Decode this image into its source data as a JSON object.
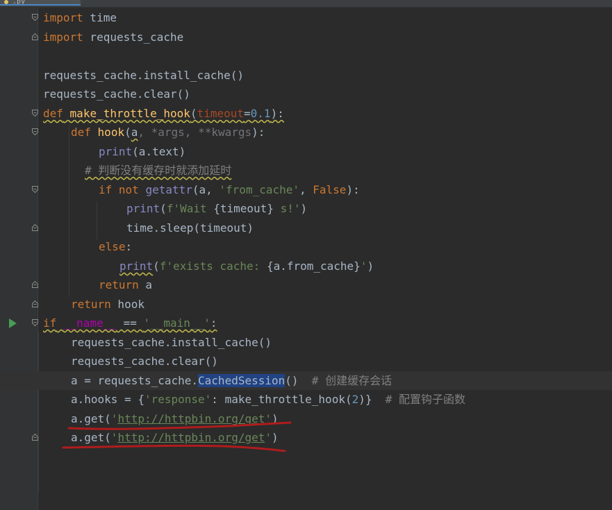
{
  "editor": {
    "tab_label": ".py",
    "colors": {
      "background": "#2b2b2b",
      "gutter": "#313335",
      "keyword": "#cc7832",
      "string": "#6a8759",
      "number": "#6897bb",
      "comment": "#808080",
      "function_def": "#ffc66d",
      "builtin": "#8888c6",
      "annotation_ink": "#b01c1c"
    },
    "lines": {
      "l1": {
        "k": "import",
        "t": " time"
      },
      "l2": {
        "k": "import",
        "t": " requests_cache"
      },
      "l4": {
        "t": "requests_cache.install_cache()"
      },
      "l5": {
        "t": "requests_cache.clear()"
      },
      "l6": {
        "k": "def",
        "sp": " ",
        "fn": "make_throttle_hook",
        "open": "(",
        "param": "timeout",
        "eq": "=",
        "num": "0.1",
        "close": "):"
      },
      "l7": {
        "k": "def",
        "sp": " ",
        "fn": "hook",
        "open": "(",
        "a": "a",
        "comma1": ", ",
        "args": "*args",
        "comma2": ", ",
        "kwargs": "**kwargs",
        "close": "):"
      },
      "l8": {
        "bi": "print",
        "t": "(a.text)"
      },
      "l9": {
        "cmt": "# 判断没有缓存时就添加延时"
      },
      "l10": {
        "k1": "if",
        "k2": " not",
        "sp": " ",
        "bi": "getattr",
        "t1": "(a, ",
        "str": "'from_cache'",
        "t2": ", ",
        "k3": "False",
        "t3": "):"
      },
      "l11": {
        "bi": "print",
        "t1": "(",
        "str1": "f'Wait ",
        "t2": "{timeout}",
        "str2": " s!'",
        "t3": ")"
      },
      "l12": {
        "t": "time.sleep(timeout)"
      },
      "l13": {
        "k": "else",
        "t": ":"
      },
      "l14": {
        "bi": "print",
        "t1": "(",
        "str1": "f'exists cache: ",
        "t2": "{a.from_cache}",
        "str2": "'",
        "t3": ")"
      },
      "l15": {
        "k": "return",
        "t": " a"
      },
      "l16": {
        "k": "return",
        "t": " hook"
      },
      "l17": {
        "k": "if",
        "sp": " ",
        "dunder": "__name__",
        "t1": " == ",
        "str": "'__main__'",
        "t2": ":"
      },
      "l18": {
        "t": "requests_cache.install_cache()"
      },
      "l19": {
        "t": "requests_cache.clear()"
      },
      "l20": {
        "t1": "a = requests_cache.",
        "sel": "CachedSession",
        "t2": "()  ",
        "cmt": "# 创建缓存会话"
      },
      "l21": {
        "t1": "a.hooks = {",
        "str": "'response'",
        "t2": ": make_throttle_hook(",
        "num": "2",
        "t3": ")}  ",
        "cmt": "# 配置钩子函数"
      },
      "l22": {
        "t1": "a.get(",
        "q1": "'",
        "url": "http://httpbin.org/get",
        "q2": "'",
        "t2": ")"
      },
      "l23": {
        "t1": "a.get(",
        "q1": "'",
        "url": "http://httpbin.org/get",
        "q2": "'",
        "t2": ")"
      }
    }
  }
}
